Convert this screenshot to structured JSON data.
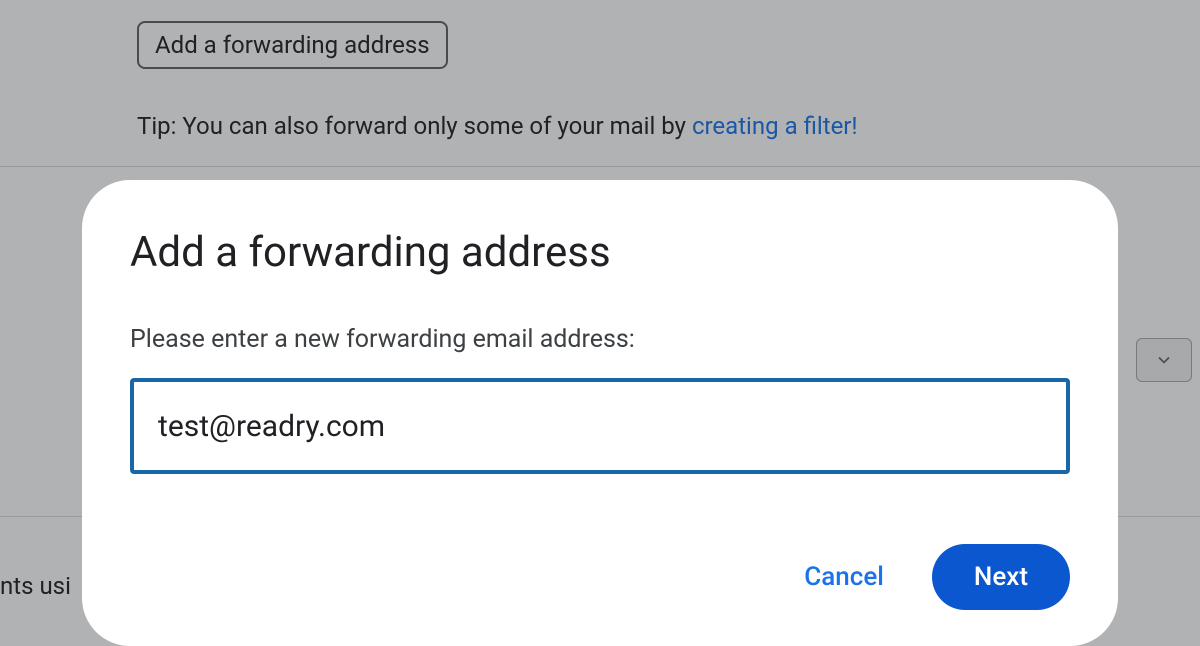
{
  "background": {
    "add_button_label": "Add a forwarding address",
    "tip_prefix": "Tip: You can also forward only some of your mail by ",
    "tip_link": "creating a filter!",
    "partial_text_left": "nts usi"
  },
  "dialog": {
    "title": "Add a forwarding address",
    "prompt": "Please enter a new forwarding email address:",
    "input_value": "test@readry.com",
    "cancel_label": "Cancel",
    "next_label": "Next"
  }
}
